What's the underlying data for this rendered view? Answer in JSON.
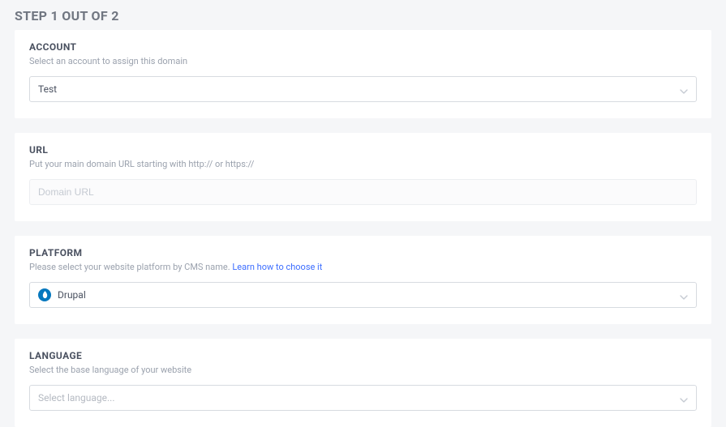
{
  "header": {
    "title": "STEP 1 OUT OF 2"
  },
  "account": {
    "title": "ACCOUNT",
    "desc": "Select an account to assign this domain",
    "value": "Test"
  },
  "url": {
    "title": "URL",
    "desc": "Put your main domain URL starting with http:// or https://",
    "placeholder": "Domain URL"
  },
  "platform": {
    "title": "PLATFORM",
    "desc_prefix": "Please select your website platform by CMS name. ",
    "link_text": "Learn how to choose it",
    "value": "Drupal"
  },
  "language": {
    "title": "LANGUAGE",
    "desc": "Select the base language of your website",
    "placeholder": "Select language..."
  }
}
